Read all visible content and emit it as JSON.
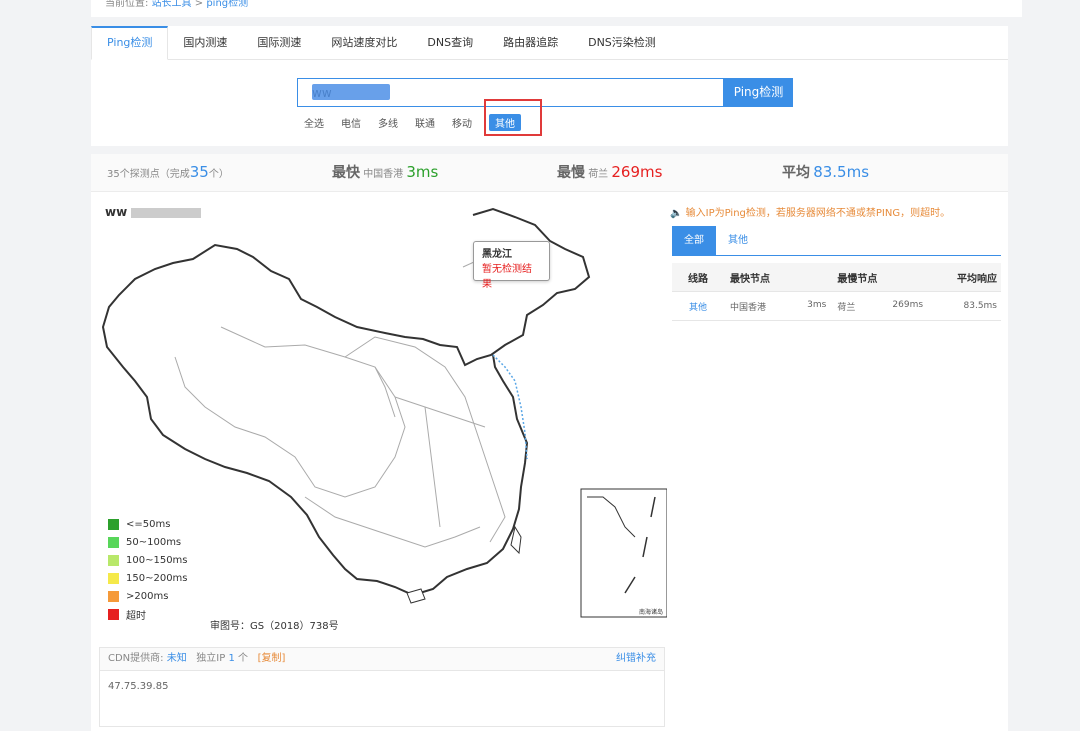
{
  "breadcrumb": {
    "prefix": "当前位置:",
    "home": "站长工具",
    "sep": ">",
    "current": "ping检测"
  },
  "tabs": [
    "Ping检测",
    "国内测速",
    "国际测速",
    "网站速度对比",
    "DNS查询",
    "路由器追踪",
    "DNS污染检测"
  ],
  "search": {
    "value": "ww",
    "button": "Ping检测"
  },
  "filters": [
    "全选",
    "电信",
    "多线",
    "联通",
    "移动",
    "其他"
  ],
  "stats": {
    "points_prefix": "35个探测点（完成",
    "points_done": "35",
    "points_suffix": "个）",
    "fastest_label": "最快",
    "fastest_node": "中国香港",
    "fastest_value": "3ms",
    "slowest_label": "最慢",
    "slowest_node": "荷兰",
    "slowest_value": "269ms",
    "avg_label": "平均",
    "avg_value": "83.5ms"
  },
  "map": {
    "title": "ww",
    "tooltip": {
      "province": "黑龙江",
      "status": "暂无检测结果"
    },
    "legend": [
      {
        "label": "<=50ms",
        "color": "#2ca02c"
      },
      {
        "label": "50~100ms",
        "color": "#58d65a"
      },
      {
        "label": "100~150ms",
        "color": "#b8e86a"
      },
      {
        "label": "150~200ms",
        "color": "#f5e94a"
      },
      {
        "label": ">200ms",
        "color": "#f59a3a"
      },
      {
        "label": "超时",
        "color": "#e62020"
      }
    ],
    "approval": "审图号：GS（2018）738号",
    "inset_caption": "南海诸岛"
  },
  "notice": "🔈 输入IP为Ping检测，若服务器网络不通或禁PING，则超时。",
  "result_tabs": [
    "全部",
    "其他"
  ],
  "result_table": {
    "headers": [
      "线路",
      "最快节点",
      "最慢节点",
      "平均响应"
    ],
    "rows": [
      {
        "line": "其他",
        "fast_node": "中国香港",
        "fast_ms": "3ms",
        "slow_node": "荷兰",
        "slow_ms": "269ms",
        "avg": "83.5ms"
      }
    ]
  },
  "cdn": {
    "provider_label": "CDN提供商:",
    "provider": "未知",
    "ip_label": "独立IP",
    "ip_count": "1",
    "ip_unit": "个",
    "copy": "[复制]",
    "fix": "纠错补充",
    "ip": "47.75.39.85"
  }
}
